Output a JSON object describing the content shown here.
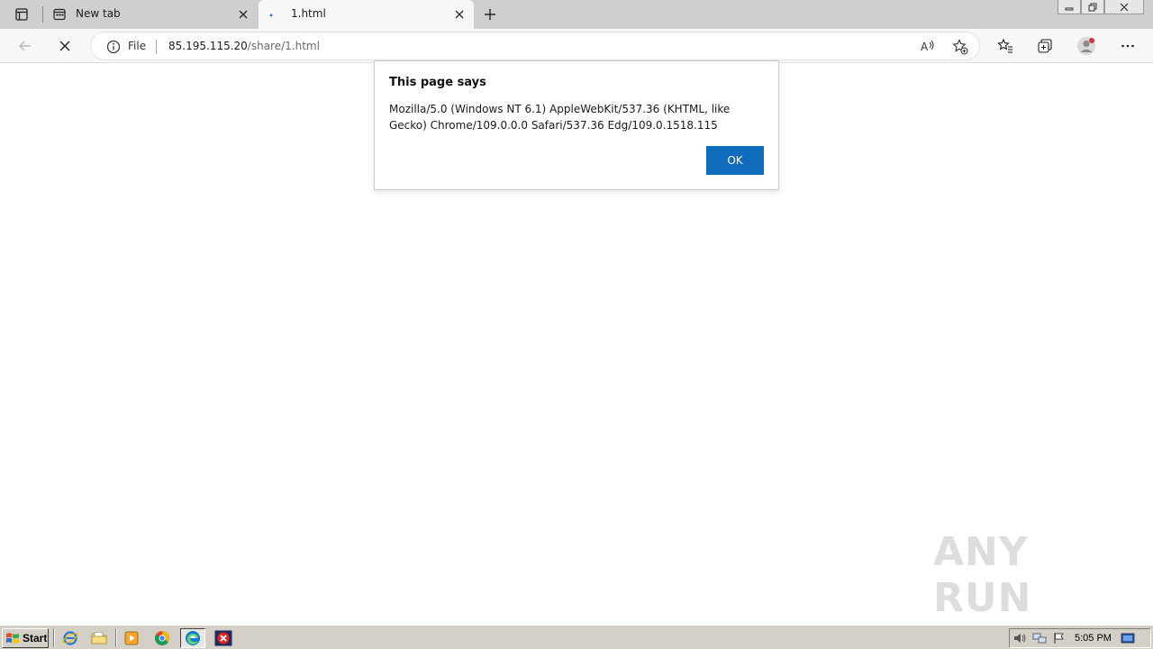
{
  "tabs": [
    {
      "title": "New tab",
      "active": false
    },
    {
      "title": "1.html",
      "active": true
    }
  ],
  "address_bar": {
    "scheme_label": "File",
    "url_host": "85.195.115.20",
    "url_path": "/share/1.html"
  },
  "dialog": {
    "title": "This page says",
    "message": "Mozilla/5.0 (Windows NT 6.1) AppleWebKit/537.36 (KHTML, like Gecko) Chrome/109.0.0.0 Safari/537.36 Edg/109.0.1518.115",
    "ok_label": "OK"
  },
  "taskbar": {
    "start_label": "Start",
    "quick_launch": [
      "ie-icon",
      "folder-icon",
      "media-player-icon",
      "chrome-icon",
      "edge-icon",
      "error-app-icon"
    ],
    "clock": "5:05 PM"
  },
  "watermark": {
    "text": "ANY RUN"
  },
  "colors": {
    "accent": "#0f6cbd",
    "tabstrip": "#cfcfcf",
    "toolbar": "#f7f7f7",
    "taskbar": "#d4d0c8"
  }
}
